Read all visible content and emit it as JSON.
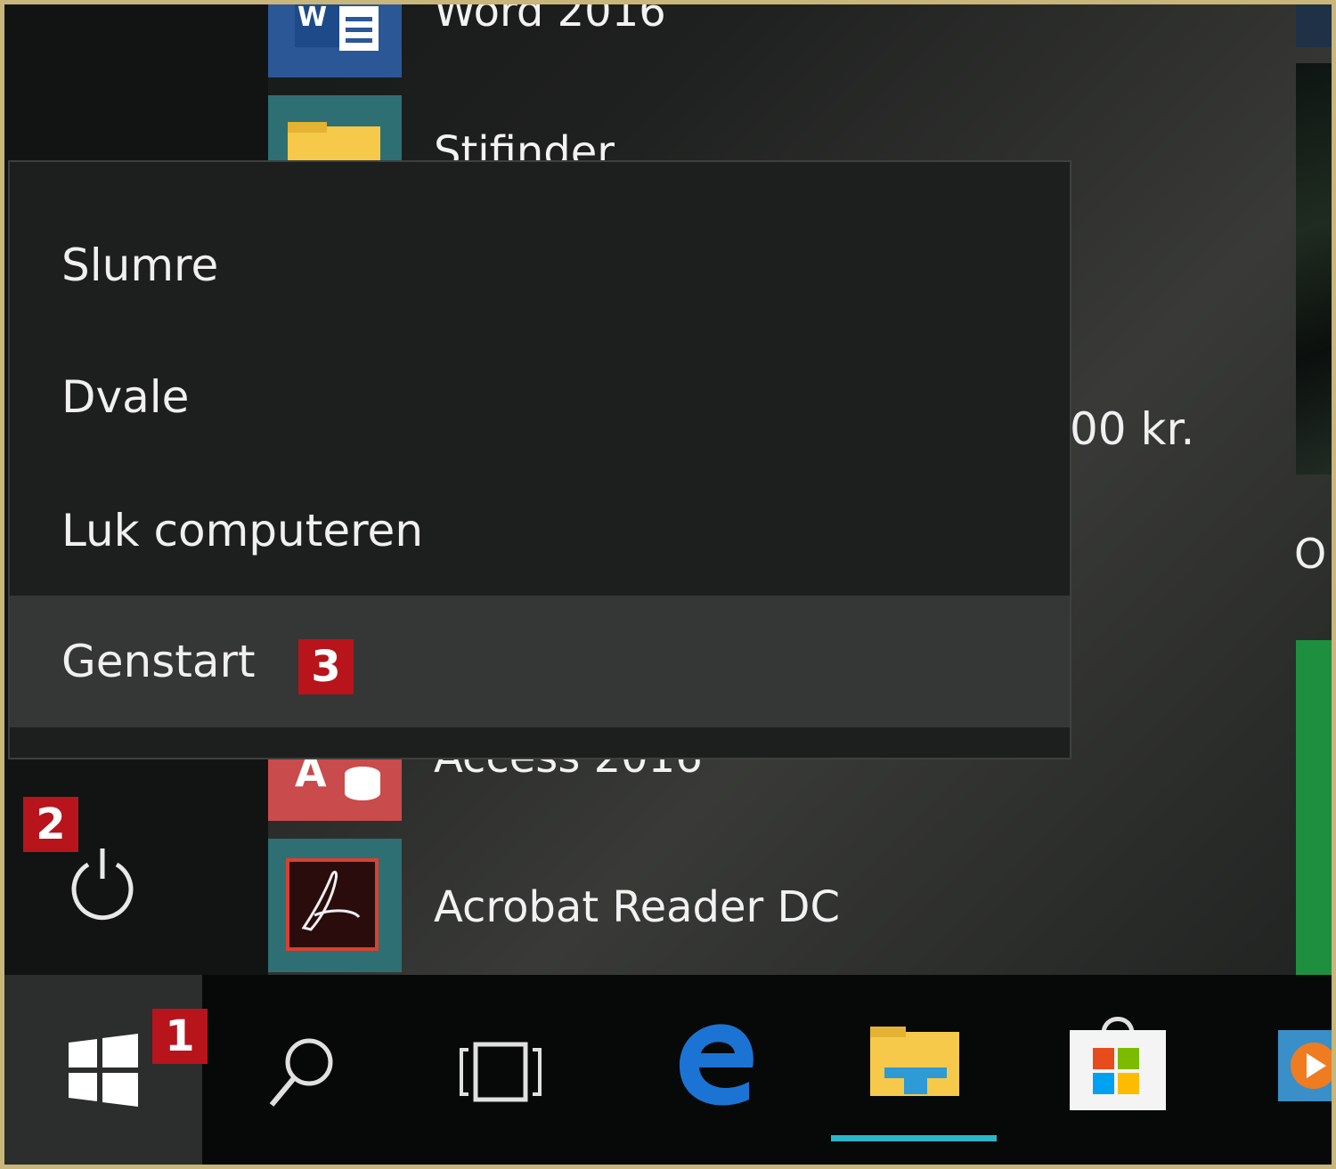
{
  "start_menu": {
    "apps": [
      {
        "label": "Word 2016",
        "icon": "word-icon",
        "color": "#2b5797"
      },
      {
        "label": "Stifinder",
        "icon": "folder-icon",
        "color": "#2d6f73"
      },
      {
        "label": "Access 2016",
        "icon": "access-icon",
        "color": "#c94b4b"
      },
      {
        "label": "Acrobat Reader DC",
        "icon": "acrobat-icon",
        "color": "#2d6f73"
      }
    ],
    "tile_text": "00 kr.",
    "tile_text_2": "O",
    "power_icon": "power-icon"
  },
  "power_menu": {
    "items": [
      {
        "label": "Slumre"
      },
      {
        "label": "Dvale"
      },
      {
        "label": "Luk computeren"
      },
      {
        "label": "Genstart"
      }
    ],
    "highlighted": "Genstart"
  },
  "badges": {
    "start": "1",
    "power": "2",
    "restart": "3"
  },
  "taskbar": {
    "icons": [
      "windows-logo-icon",
      "search-icon",
      "task-view-icon",
      "edge-icon",
      "file-explorer-icon",
      "store-icon",
      "media-player-icon"
    ],
    "active": "file-explorer-icon"
  },
  "colors": {
    "badge": "#b8141c",
    "accent": "#2bb5c8",
    "green_tile": "#1e8f3e"
  }
}
